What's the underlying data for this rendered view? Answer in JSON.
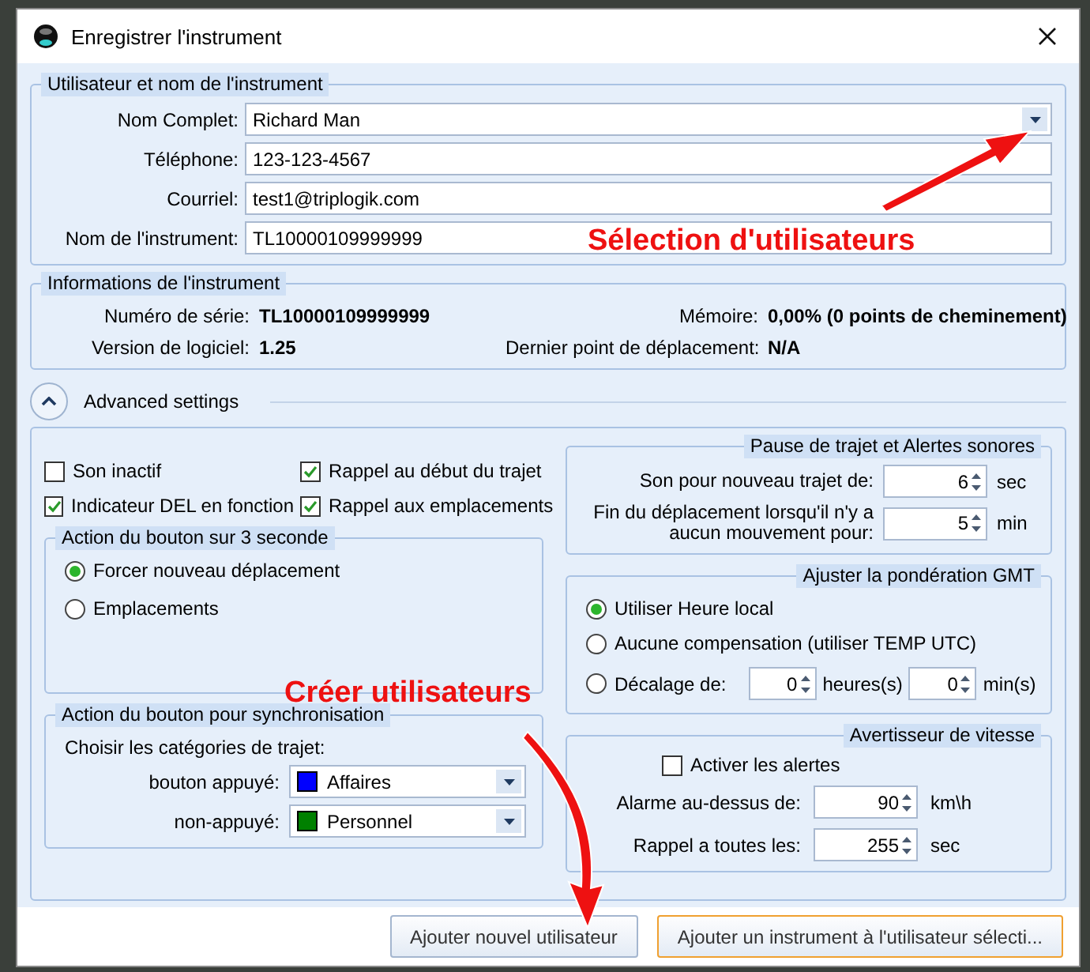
{
  "window": {
    "title": "Enregistrer l'instrument"
  },
  "user_group": {
    "title": "Utilisateur et nom de l'instrument",
    "fields": [
      {
        "label": "Nom Complet:",
        "value": "Richard Man",
        "kind": "dropdown"
      },
      {
        "label": "Téléphone:",
        "value": "123-123-4567",
        "kind": "text"
      },
      {
        "label": "Courriel:",
        "value": "test1@triplogik.com",
        "kind": "text"
      },
      {
        "label": "Nom de l'instrument:",
        "value": "TL10000109999999",
        "kind": "text"
      }
    ]
  },
  "info_group": {
    "title": "Informations de l'instrument",
    "items": [
      {
        "label": "Numéro de série:",
        "value": "TL10000109999999"
      },
      {
        "label": "Mémoire:",
        "value": "0,00% (0 points de cheminement)"
      },
      {
        "label": "Version de logiciel:",
        "value": "1.25"
      },
      {
        "label": "Dernier point de déplacement:",
        "value": "N/A"
      }
    ]
  },
  "advanced": {
    "label": "Advanced settings",
    "expanded": true
  },
  "options": [
    {
      "label": "Son inactif",
      "checked": false
    },
    {
      "label": "Rappel au début du trajet",
      "checked": true
    },
    {
      "label": "Indicateur DEL en fonction",
      "checked": true
    },
    {
      "label": "Rappel aux emplacements",
      "checked": true
    }
  ],
  "button_action": {
    "title": "Action du bouton sur 3 seconde",
    "options": [
      {
        "label": "Forcer nouveau déplacement",
        "selected": true
      },
      {
        "label": "Emplacements",
        "selected": false
      }
    ]
  },
  "sync_action": {
    "title": "Action du bouton pour synchronisation",
    "prompt": "Choisir les catégories de trajet:",
    "rows": [
      {
        "label": "bouton appuyé:",
        "value": "Affaires",
        "color": "#0000ff"
      },
      {
        "label": "non-appuyé:",
        "value": "Personnel",
        "color": "#008000"
      }
    ]
  },
  "pause_group": {
    "title": "Pause de trajet et Alertes sonores",
    "rows": [
      {
        "label": "Son pour nouveau trajet de:",
        "value": "6",
        "unit": "sec"
      },
      {
        "label": "Fin du déplacement lorsqu'il n'y a aucun mouvement pour:",
        "value": "5",
        "unit": "min"
      }
    ]
  },
  "gmt_group": {
    "title": "Ajuster la pondération GMT",
    "options": [
      {
        "label": "Utiliser Heure local",
        "selected": true,
        "kind": "plain"
      },
      {
        "label": "Aucune compensation (utiliser TEMP UTC)",
        "selected": false,
        "kind": "plain"
      },
      {
        "label": "Décalage de:",
        "selected": false,
        "kind": "offset",
        "hours": "0",
        "hours_unit": "heures(s)",
        "minutes": "0",
        "minutes_unit": "min(s)"
      }
    ]
  },
  "speed_group": {
    "title": "Avertisseur de vitesse",
    "alerts": {
      "label": "Activer les alertes",
      "checked": false
    },
    "rows": [
      {
        "label": "Alarme au-dessus de:",
        "value": "90",
        "unit": "km\\h"
      },
      {
        "label": "Rappel a toutes les:",
        "value": "255",
        "unit": "sec"
      }
    ]
  },
  "buttons": [
    {
      "label": "Ajouter nouvel utilisateur",
      "default": false
    },
    {
      "label": "Ajouter un instrument à l'utilisateur sélecti...",
      "default": true
    }
  ],
  "annotations": [
    {
      "text": "Sélection d'utilisateurs",
      "kind": "straight"
    },
    {
      "text": "Créer utilisateurs",
      "kind": "curved"
    }
  ]
}
